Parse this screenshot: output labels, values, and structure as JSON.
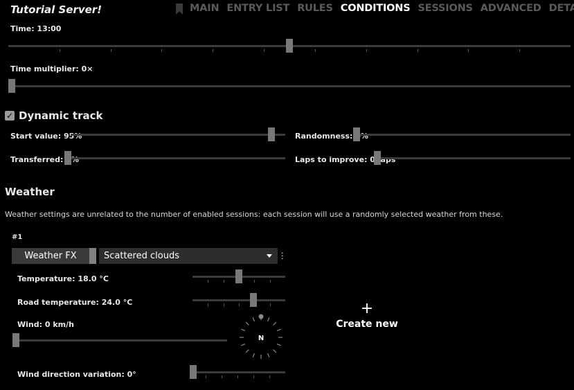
{
  "app": {
    "title": "Tutorial Server!"
  },
  "tabs": [
    {
      "label": "MAIN",
      "active": false
    },
    {
      "label": "ENTRY LIST",
      "active": false
    },
    {
      "label": "RULES",
      "active": false
    },
    {
      "label": "CONDITIONS",
      "active": true
    },
    {
      "label": "SESSIONS",
      "active": false
    },
    {
      "label": "ADVANCED",
      "active": false
    },
    {
      "label": "DETAILS",
      "active": false
    }
  ],
  "time": {
    "label": "Time: 13:00",
    "level": 0.5
  },
  "time_multiplier": {
    "label": "Time multiplier: 0×",
    "level": 0.0
  },
  "dynamic_track": {
    "title": "Dynamic track",
    "checked": true,
    "start_value": {
      "label": "Start value: 95%",
      "level": 0.95
    },
    "randomness": {
      "label": "Randomness: 0%",
      "level": 0.0
    },
    "transferred": {
      "label": "Transferred: 0%",
      "level": 0.0
    },
    "laps_to_improve": {
      "label": "Laps to improve: 0 laps",
      "level": 0.0
    }
  },
  "weather": {
    "title": "Weather",
    "description": "Weather settings are unrelated to the number of enabled sessions: each session will use a randomly selected weather from these.",
    "entries": [
      {
        "index_label": "#1",
        "fx_button": "Weather FX",
        "selected_weather": "Scattered clouds",
        "temperature": {
          "label": "Temperature: 18.0 °C",
          "level": 0.5
        },
        "road_temperature": {
          "label": "Road temperature: 24.0 °C",
          "level": 0.67
        },
        "wind": {
          "label": "Wind: 0 km/h",
          "level": 0.0
        },
        "wind_direction_variation": {
          "label": "Wind direction variation: 0°",
          "level": 0.0
        },
        "compass_label": "N"
      }
    ],
    "create_new": {
      "icon": "plus-icon",
      "label": "Create new"
    }
  },
  "colors": {
    "background": "#000000",
    "active_tab": "#ffffff",
    "inactive_tab": "#5a5a5a",
    "thumb": "#787878",
    "track": "#3b3b3b"
  }
}
